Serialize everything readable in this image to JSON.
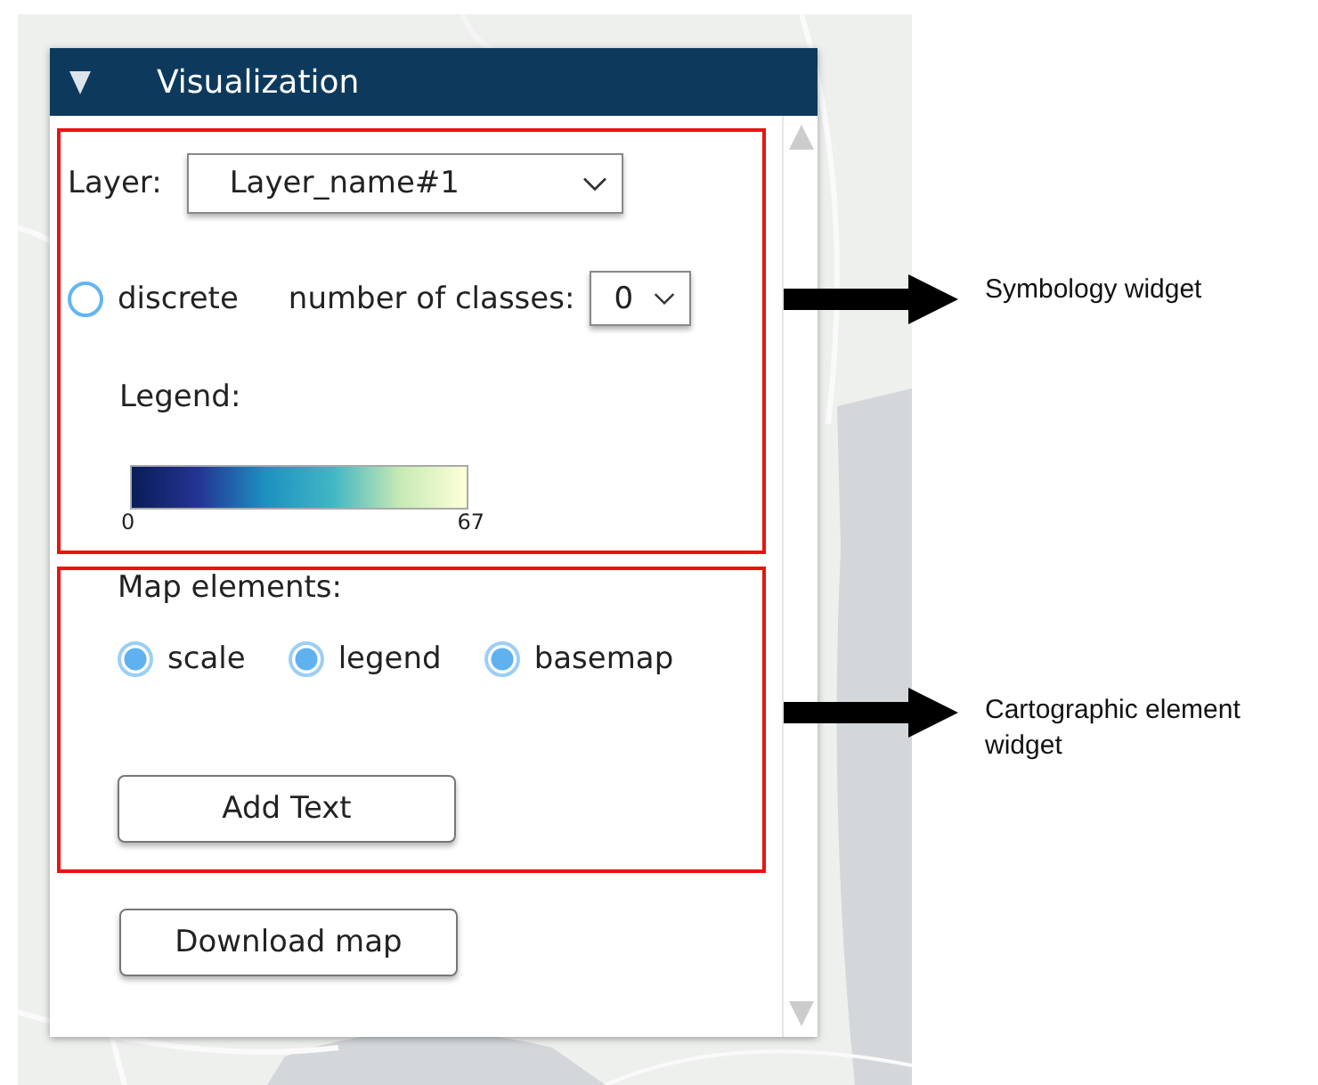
{
  "panel": {
    "title": "Visualization",
    "expanded": true
  },
  "symbology": {
    "layer_label": "Layer:",
    "layer_value": "Layer_name#1",
    "discrete": {
      "label": "discrete",
      "checked": false
    },
    "classes_label": "number of classes:",
    "classes_value": "0",
    "legend_label": "Legend:",
    "legend_min": "0",
    "legend_max": "67"
  },
  "map_elements": {
    "label": "Map elements:",
    "options": [
      {
        "label": "scale",
        "checked": true
      },
      {
        "label": "legend",
        "checked": true
      },
      {
        "label": "basemap",
        "checked": true
      }
    ],
    "add_text_button": "Add Text"
  },
  "download_button": "Download map",
  "annotations": [
    {
      "label": "Symbology widget"
    },
    {
      "label": "Cartographic element widget"
    }
  ]
}
